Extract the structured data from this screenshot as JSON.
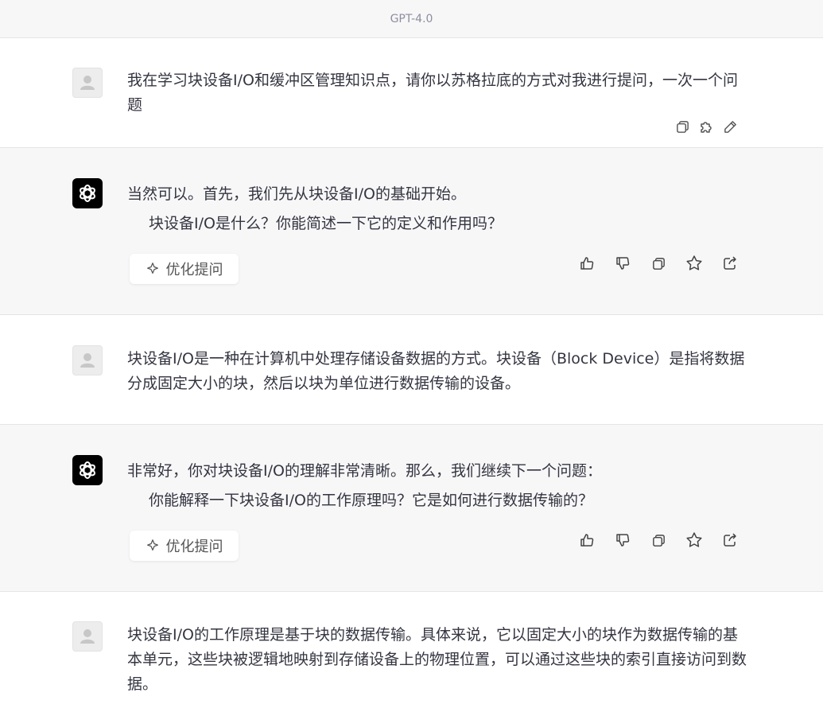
{
  "header": {
    "model": "GPT-4.0"
  },
  "messages": [
    {
      "role": "user",
      "text": "我在学习块设备I/O和缓冲区管理知识点，请你以苏格拉底的方式对我进行提问，一次一个问题"
    },
    {
      "role": "assistant",
      "lines": [
        "当然可以。首先，我们先从块设备I/O的基础开始。",
        "块设备I/O是什么？你能简述一下它的定义和作用吗？"
      ],
      "optimize_label": "优化提问"
    },
    {
      "role": "user",
      "text": "块设备I/O是一种在计算机中处理存储设备数据的方式。块设备（Block Device）是指将数据分成固定大小的块，然后以块为单位进行数据传输的设备。"
    },
    {
      "role": "assistant",
      "lines": [
        "非常好，你对块设备I/O的理解非常清晰。那么，我们继续下一个问题：",
        "你能解释一下块设备I/O的工作原理吗？它是如何进行数据传输的？"
      ],
      "optimize_label": "优化提问"
    },
    {
      "role": "user",
      "text": "块设备I/O的工作原理是基于块的数据传输。具体来说，它以固定大小的块作为数据传输的基本单元，这些块被逻辑地映射到存储设备上的物理位置，可以通过这些块的索引直接访问到数据。"
    }
  ],
  "icons": {
    "user_actions": [
      "copy-icon",
      "plugin-icon",
      "edit-icon"
    ],
    "bot_actions": [
      "thumbs-up-icon",
      "thumbs-down-icon",
      "copy-icon",
      "star-icon",
      "share-icon"
    ],
    "optimize": "sparkle-icon",
    "user_avatar": "user-avatar-icon",
    "bot_avatar": "openai-logo-icon"
  }
}
